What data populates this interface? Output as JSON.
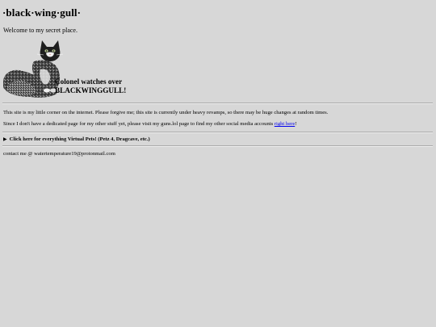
{
  "header": {
    "title": "·black·wing·gull·",
    "welcome": "Welcome to my secret place."
  },
  "banner": {
    "caption_line1": "Colonel watches over",
    "caption_line2": "BLACKWINGGULL!"
  },
  "content": {
    "intro": "This site is my little corner on the internet. Please forgive me; this site is currently under heavy revamps, so there may be huge changes at random times.",
    "social_before": "Since I don't have a dedicated page for my other stuff yet, please visit my guns.lol page to find my other social media accounts ",
    "social_link": "right here",
    "social_after": "!",
    "details_summary": "Click here for everything Virtual Pets! (Petz 4, Dragcave, etc.)",
    "contact": "contact me @ watertemperature19@protonmail.com"
  }
}
